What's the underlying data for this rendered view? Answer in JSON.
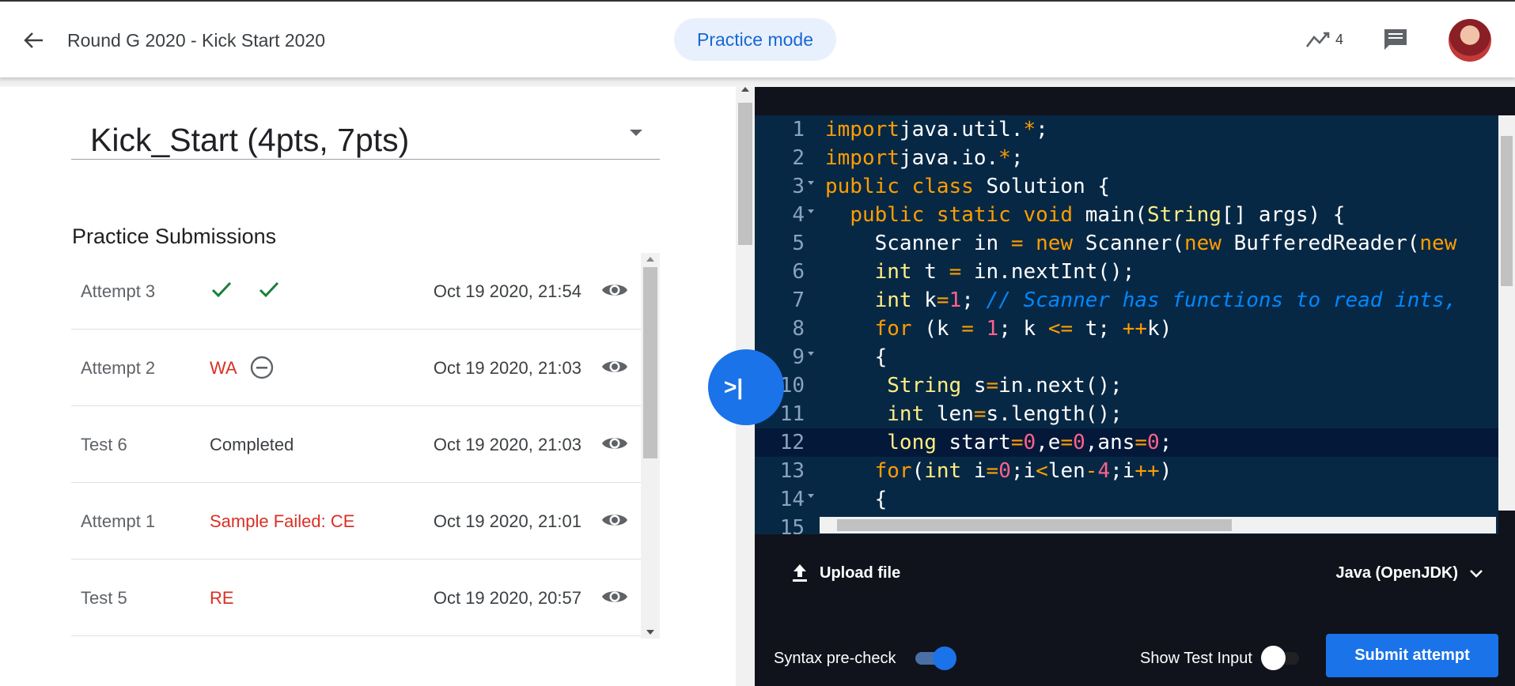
{
  "header": {
    "title": "Round G 2020 - Kick Start 2020",
    "mode_chip": "Practice mode",
    "trend_count": "4"
  },
  "problem_select": {
    "value": "Kick_Start (4pts, 7pts)"
  },
  "submissions": {
    "title": "Practice Submissions",
    "rows": [
      {
        "name": "Attempt 3",
        "status": "",
        "status_icons": [
          "check-icon",
          "check-icon"
        ],
        "time": "Oct 19 2020, 21:54",
        "status_color": "#188038"
      },
      {
        "name": "Attempt 2",
        "status": "WA",
        "status_icons": [
          "minus-circle-icon"
        ],
        "time": "Oct 19 2020, 21:03",
        "status_color": "#d93025"
      },
      {
        "name": "Test 6",
        "status": "Completed",
        "status_icons": [],
        "time": "Oct 19 2020, 21:03",
        "status_color": "#3c4043"
      },
      {
        "name": "Attempt 1",
        "status": "Sample Failed: CE",
        "status_icons": [],
        "time": "Oct 19 2020, 21:01",
        "status_color": "#d93025"
      },
      {
        "name": "Test 5",
        "status": "RE",
        "status_icons": [],
        "time": "Oct 19 2020, 20:57",
        "status_color": "#d93025"
      }
    ]
  },
  "editor": {
    "lines": [
      {
        "n": "1",
        "fold": false,
        "indent": "",
        "tokens": [
          [
            "kw",
            "import"
          ],
          [
            "",
            "java.util."
          ],
          [
            "op",
            "*"
          ],
          [
            "",
            ";"
          ]
        ]
      },
      {
        "n": "2",
        "fold": false,
        "indent": "",
        "tokens": [
          [
            "kw",
            "import"
          ],
          [
            "",
            "java.io."
          ],
          [
            "op",
            "*"
          ],
          [
            "",
            ";"
          ]
        ]
      },
      {
        "n": "3",
        "fold": true,
        "indent": "",
        "tokens": [
          [
            "kw",
            "public class"
          ],
          [
            "",
            " Solution {"
          ]
        ]
      },
      {
        "n": "4",
        "fold": true,
        "indent": "  ",
        "tokens": [
          [
            "kw",
            "public static void"
          ],
          [
            "",
            " main("
          ],
          [
            "ty",
            "String"
          ],
          [
            "",
            "[] args) {"
          ]
        ]
      },
      {
        "n": "5",
        "fold": false,
        "indent": "    ",
        "tokens": [
          [
            "",
            "Scanner in "
          ],
          [
            "op",
            "="
          ],
          [
            "",
            ""
          ],
          [
            "kw",
            " new"
          ],
          [
            "",
            " Scanner("
          ],
          [
            "kw",
            "new"
          ],
          [
            "",
            " BufferedReader("
          ],
          [
            "kw",
            "new"
          ]
        ]
      },
      {
        "n": "6",
        "fold": false,
        "indent": "    ",
        "tokens": [
          [
            "ty",
            "int"
          ],
          [
            "",
            " t "
          ],
          [
            "op",
            "="
          ],
          [
            "",
            " in.nextInt();"
          ]
        ]
      },
      {
        "n": "7",
        "fold": false,
        "indent": "    ",
        "tokens": [
          [
            "ty",
            "int"
          ],
          [
            "",
            " k"
          ],
          [
            "op",
            "="
          ],
          [
            "nu",
            "1"
          ],
          [
            "",
            "; "
          ],
          [
            "cm",
            "// Scanner has functions to read ints,"
          ]
        ]
      },
      {
        "n": "8",
        "fold": false,
        "indent": "    ",
        "tokens": [
          [
            "kw",
            "for"
          ],
          [
            "",
            " (k "
          ],
          [
            "op",
            "="
          ],
          [
            "",
            " "
          ],
          [
            "nu",
            "1"
          ],
          [
            "",
            "; k "
          ],
          [
            "op",
            "<="
          ],
          [
            "",
            " t; "
          ],
          [
            "op",
            "++"
          ],
          [
            "",
            "k)"
          ]
        ]
      },
      {
        "n": "9",
        "fold": true,
        "indent": "    ",
        "tokens": [
          [
            "",
            "{"
          ]
        ]
      },
      {
        "n": "10",
        "fold": false,
        "indent": "     ",
        "tokens": [
          [
            "ty",
            "String"
          ],
          [
            "",
            " s"
          ],
          [
            "op",
            "="
          ],
          [
            "",
            "in.next();"
          ]
        ]
      },
      {
        "n": "11",
        "fold": false,
        "indent": "     ",
        "tokens": [
          [
            "ty",
            "int"
          ],
          [
            "",
            " len"
          ],
          [
            "op",
            "="
          ],
          [
            "",
            "s.length();"
          ]
        ]
      },
      {
        "n": "12",
        "fold": false,
        "indent": "     ",
        "tokens": [
          [
            "ty",
            "long"
          ],
          [
            "",
            " start"
          ],
          [
            "op",
            "="
          ],
          [
            "nu",
            "0"
          ],
          [
            "",
            ",e"
          ],
          [
            "op",
            "="
          ],
          [
            "nu",
            "0"
          ],
          [
            "",
            ",ans"
          ],
          [
            "op",
            "="
          ],
          [
            "nu",
            "0"
          ],
          [
            "",
            ";"
          ]
        ]
      },
      {
        "n": "13",
        "fold": false,
        "indent": "    ",
        "tokens": [
          [
            "kw",
            "for"
          ],
          [
            "",
            "("
          ],
          [
            "ty",
            "int"
          ],
          [
            "",
            " i"
          ],
          [
            "op",
            "="
          ],
          [
            "nu",
            "0"
          ],
          [
            "",
            ";i"
          ],
          [
            "op",
            "<"
          ],
          [
            "",
            "len"
          ],
          [
            "op",
            "-"
          ],
          [
            "nu",
            "4"
          ],
          [
            "",
            ";i"
          ],
          [
            "op",
            "++"
          ],
          [
            "",
            ")"
          ]
        ]
      },
      {
        "n": "14",
        "fold": true,
        "indent": "    ",
        "tokens": [
          [
            "",
            "{"
          ]
        ]
      },
      {
        "n": "15",
        "fold": false,
        "indent": "",
        "tokens": []
      }
    ],
    "active_line": "12"
  },
  "footer": {
    "upload_label": "Upload file",
    "language": "Java (OpenJDK)",
    "syntax_label": "Syntax pre-check",
    "syntax_on": true,
    "show_input_label": "Show Test Input",
    "show_input_on": false,
    "submit_label": "Submit attempt"
  },
  "colors": {
    "accent": "#1a73e8",
    "success": "#188038",
    "error": "#d93025",
    "editor_bg": "#072845"
  }
}
